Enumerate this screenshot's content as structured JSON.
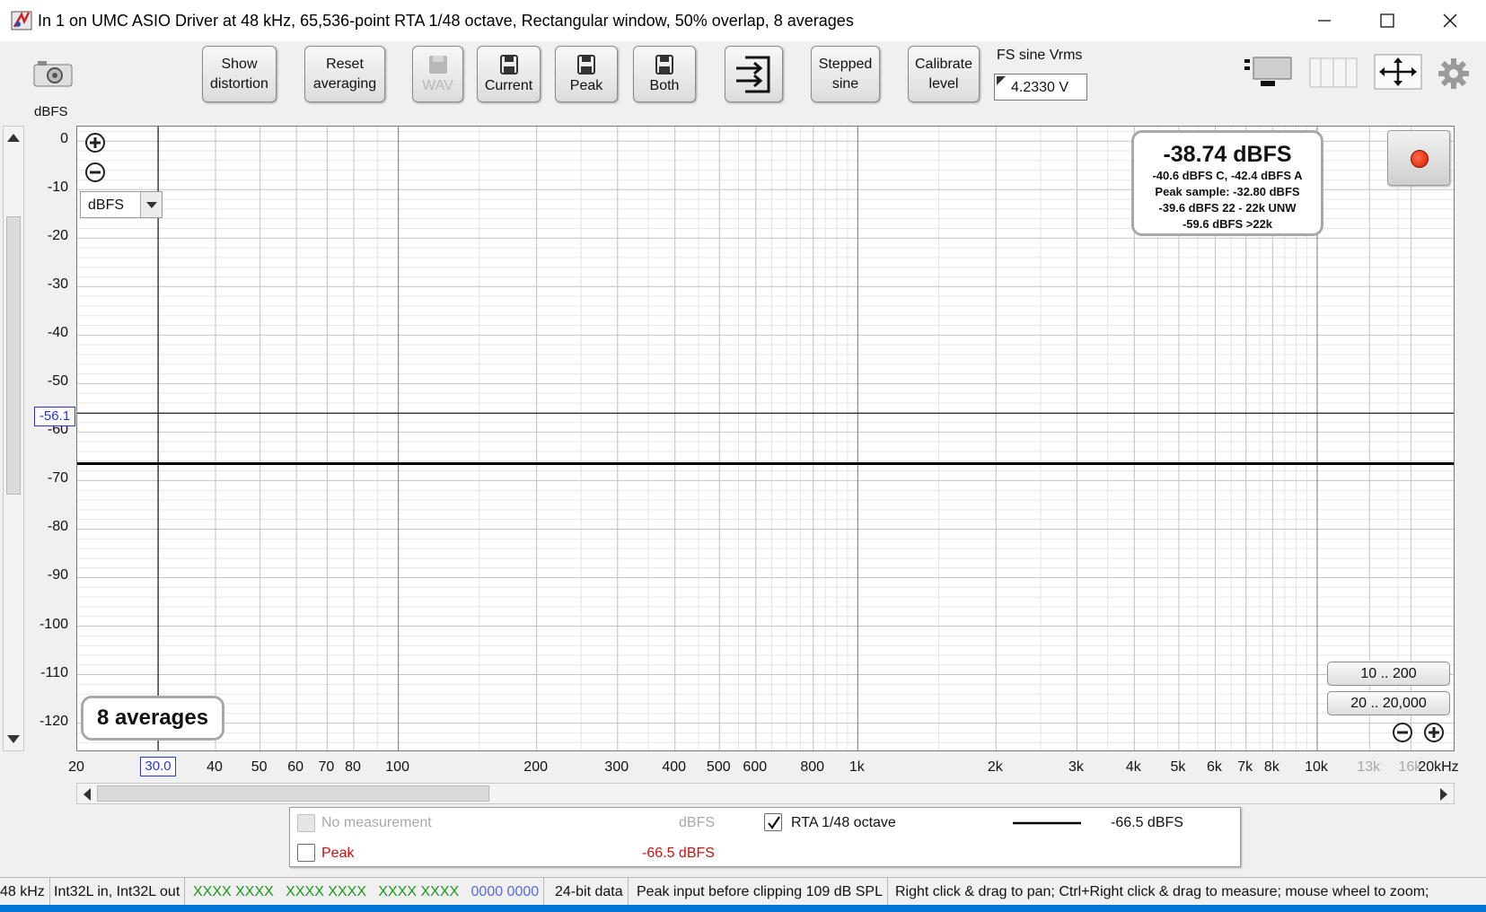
{
  "window": {
    "title": "In 1 on UMC ASIO Driver at 48 kHz, 65,536-point RTA 1/48 octave, Rectangular window, 50% overlap, 8 averages"
  },
  "toolbar": {
    "show_distortion_1": "Show",
    "show_distortion_2": "distortion",
    "reset_averaging_1": "Reset",
    "reset_averaging_2": "averaging",
    "wav": "WAV",
    "current": "Current",
    "peak": "Peak",
    "both": "Both",
    "stepped_sine_1": "Stepped",
    "stepped_sine_2": "sine",
    "calibrate_level_1": "Calibrate",
    "calibrate_level_2": "level",
    "fs_sine_label": "FS sine Vrms",
    "fs_sine_value": "4.2330 V"
  },
  "chart_data": {
    "type": "line",
    "ylabel": "dBFS",
    "ylim": [
      -126,
      3
    ],
    "xlim": [
      20,
      20000
    ],
    "xscale": "log",
    "grid": true,
    "y_ticks": [
      "0",
      "-10",
      "-20",
      "-30",
      "-40",
      "-50",
      "-60",
      "-70",
      "-80",
      "-90",
      "-100",
      "-110",
      "-120"
    ],
    "x_ticks": [
      {
        "label": "20",
        "value": 20
      },
      {
        "label": "40",
        "value": 40
      },
      {
        "label": "50",
        "value": 50
      },
      {
        "label": "60",
        "value": 60
      },
      {
        "label": "70",
        "value": 70
      },
      {
        "label": "80",
        "value": 80
      },
      {
        "label": "100",
        "value": 100
      },
      {
        "label": "200",
        "value": 200
      },
      {
        "label": "300",
        "value": 300
      },
      {
        "label": "400",
        "value": 400
      },
      {
        "label": "500",
        "value": 500
      },
      {
        "label": "600",
        "value": 600
      },
      {
        "label": "800",
        "value": 800
      },
      {
        "label": "1k",
        "value": 1000
      },
      {
        "label": "2k",
        "value": 2000
      },
      {
        "label": "3k",
        "value": 3000
      },
      {
        "label": "4k",
        "value": 4000
      },
      {
        "label": "5k",
        "value": 5000
      },
      {
        "label": "6k",
        "value": 6000
      },
      {
        "label": "7k",
        "value": 7000
      },
      {
        "label": "8k",
        "value": 8000
      },
      {
        "label": "10k",
        "value": 10000
      },
      {
        "label": "13k",
        "value": 13000,
        "faded": true
      },
      {
        "label": "16k",
        "value": 16000,
        "faded": true
      },
      {
        "label": "20kHz",
        "value": 20000
      }
    ],
    "series": [
      {
        "name": "RTA 1/48 octave",
        "color": "#000000",
        "x": [
          20,
          20000
        ],
        "y": [
          -66.5,
          -66.5
        ]
      }
    ],
    "cursor": {
      "x": 30.0,
      "y": -56.1,
      "x_label": "30.0",
      "y_label": "-56.1"
    }
  },
  "plot": {
    "unit_select": "dBFS",
    "averages_label": "8 averages",
    "range_btn_1": "10 .. 200",
    "range_btn_2": "20 .. 20,000"
  },
  "level_meter": {
    "main": "-38.74 dBFS",
    "line1": "-40.6 dBFS C, -42.4 dBFS A",
    "line2": "Peak sample: -32.80 dBFS",
    "line3": "-39.6 dBFS 22 - 22k UNW",
    "line4": "-59.6 dBFS >22k"
  },
  "legend": {
    "no_measurement": "No measurement",
    "no_measurement_unit": "dBFS",
    "peak": "Peak",
    "peak_value": "-66.5 dBFS",
    "rta": "RTA 1/48 octave",
    "rta_value": "-66.5 dBFS",
    "peak_color": "#cc1010",
    "disabled_color": "#a8a8a8"
  },
  "status": {
    "rate": "48 kHz",
    "format": "Int32L in, Int32L out",
    "bits_a": "XXXX XXXX",
    "bits_b": "XXXX XXXX",
    "bits_c": "XXXX XXXX",
    "bits_d": "0000 0000",
    "depth": "24-bit data",
    "peak_input": "Peak input before clipping 109 dB SPL",
    "hint": "Right click & drag to pan; Ctrl+Right click & drag to measure; mouse wheel to zoom;",
    "bits_color": "#1a9a1a",
    "bits_d_color": "#5a6ae8"
  }
}
